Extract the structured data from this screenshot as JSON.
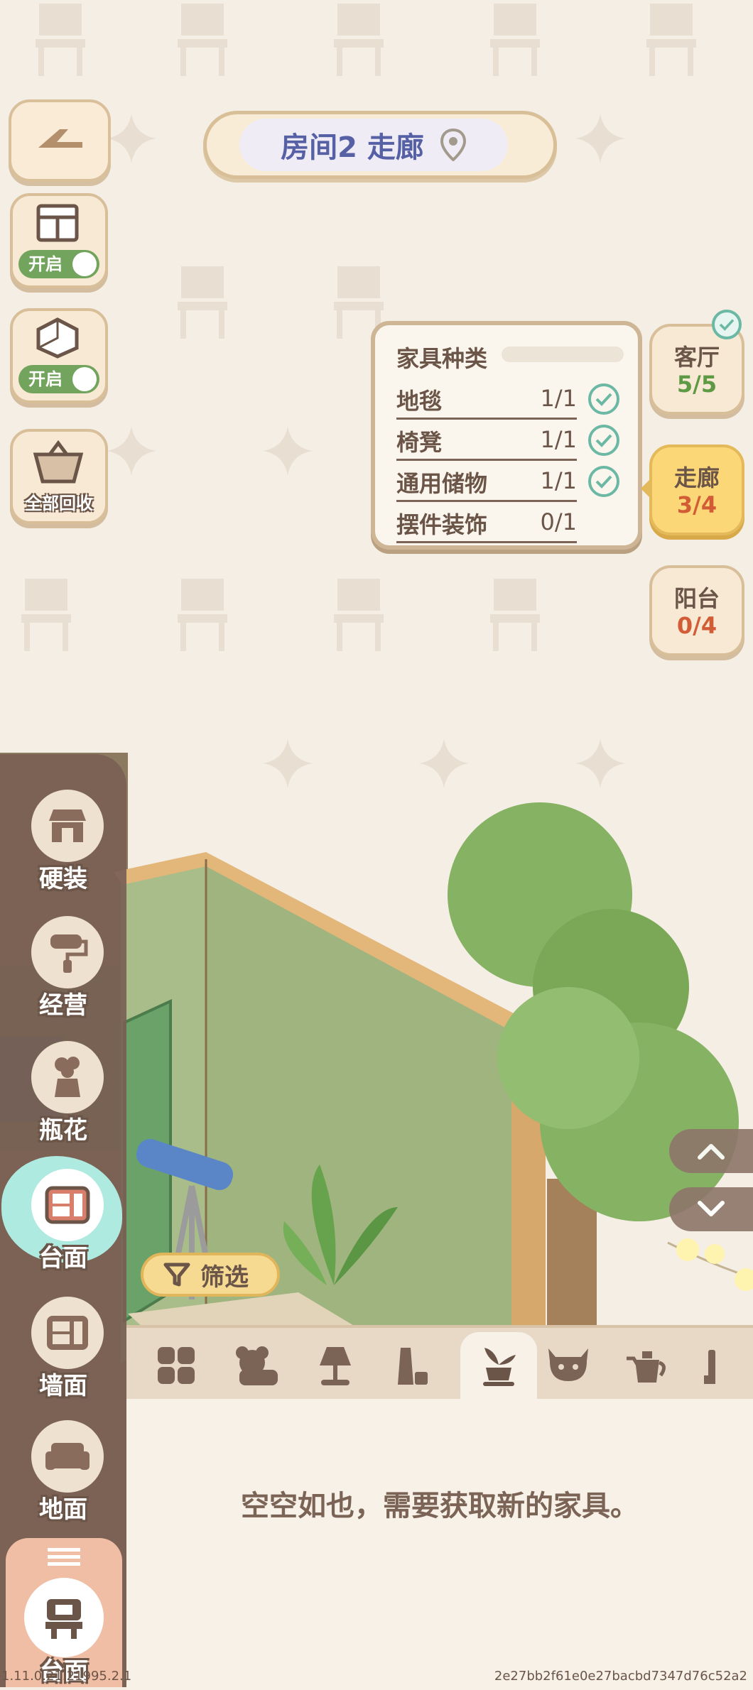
{
  "header": {
    "room_title": "房间2 走廊"
  },
  "left_controls": {
    "toggle1_label": "开启",
    "toggle2_label": "开启",
    "recycle_label": "全部回收"
  },
  "furniture_panel": {
    "title": "家具种类",
    "rows": [
      {
        "name": "地毯",
        "count": "1/1",
        "done": true
      },
      {
        "name": "椅凳",
        "count": "1/1",
        "done": true
      },
      {
        "name": "通用储物",
        "count": "1/1",
        "done": true
      },
      {
        "name": "摆件装饰",
        "count": "0/1",
        "done": false
      }
    ]
  },
  "rooms": [
    {
      "name": "客厅",
      "count": "5/5",
      "count_color": "#5e9a44",
      "complete": true
    },
    {
      "name": "走廊",
      "count": "3/4",
      "count_color": "#d25c35",
      "active": true
    },
    {
      "name": "阳台",
      "count": "0/4",
      "count_color": "#d25c35"
    }
  ],
  "categories": [
    {
      "label": "硬装"
    },
    {
      "label": "经营"
    },
    {
      "label": "瓶花"
    },
    {
      "label": "台面",
      "active": true
    },
    {
      "label": "墙面"
    },
    {
      "label": "地面"
    }
  ],
  "bottom_category": {
    "label": "台面"
  },
  "filter": {
    "label": "筛选"
  },
  "item_tabs": [
    "all-grid-icon",
    "bear-toy-icon",
    "lamp-icon",
    "bottle-icon",
    "potted-plant-icon",
    "cow-icon",
    "kettle-icon",
    "more-icon"
  ],
  "empty_message": "空空如也，需要获取新的家具。",
  "footer": {
    "version": "1.11.0.21.21995.2.1",
    "hash": "2e27bb2f61e0e27bacbd7347d76c52a2"
  }
}
